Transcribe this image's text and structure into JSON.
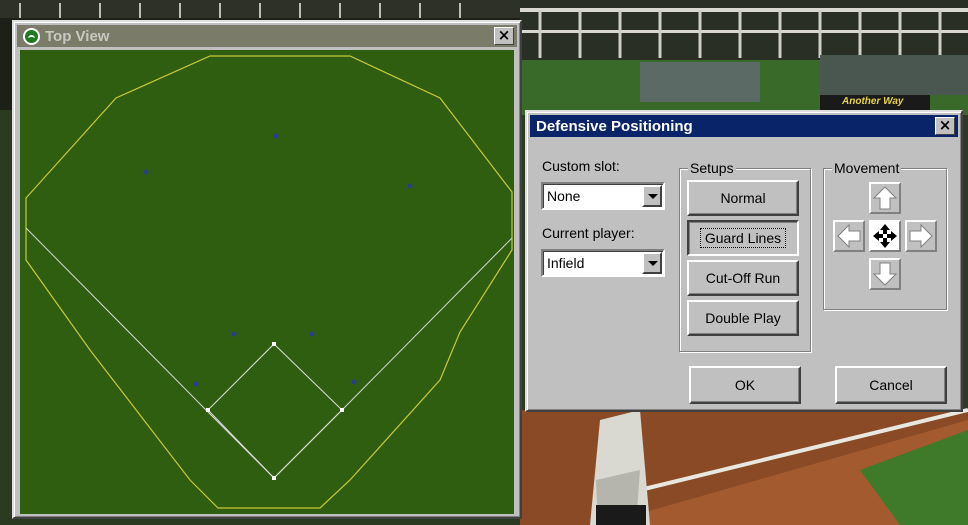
{
  "top_view": {
    "title": "Top View",
    "close_glyph": "×",
    "icon": "baseball-icon"
  },
  "defensive": {
    "title": "Defensive Positioning",
    "close_glyph": "×",
    "custom_slot_label": "Custom slot:",
    "custom_slot_value": "None",
    "current_player_label": "Current player:",
    "current_player_value": "Infield",
    "setups_label": "Setups",
    "setups": [
      "Normal",
      "Guard Lines",
      "Cut-Off Run",
      "Double Play"
    ],
    "focused_setup": "Guard Lines",
    "movement_label": "Movement",
    "movement_icons": [
      "arrow-up-icon",
      "arrow-left-icon",
      "move-center-icon",
      "arrow-right-icon",
      "arrow-down-icon"
    ],
    "ok_label": "OK",
    "cancel_label": "Cancel"
  },
  "scoreboard_text": "Another Way",
  "colors": {
    "field_green": "#2f5e10",
    "foul_line_yellow": "#c8c83a",
    "player_dot": "#2b3f8c",
    "active_title": "#0a246a",
    "inactive_title": "#7b7b6a"
  }
}
